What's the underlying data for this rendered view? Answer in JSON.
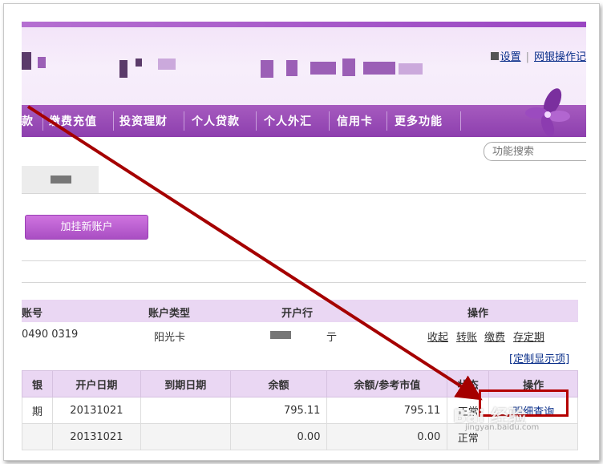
{
  "header": {
    "links": [
      "设置",
      "网银操作记"
    ],
    "search_placeholder": "功能搜索"
  },
  "nav": {
    "items": [
      "款",
      "缴费充值",
      "投资理财",
      "个人贷款",
      "个人外汇",
      "信用卡",
      "更多功能"
    ]
  },
  "actions": {
    "add_account": "加挂新账户"
  },
  "account_table": {
    "headers": [
      "账号",
      "账户类型",
      "开户行",
      "操作"
    ],
    "row": {
      "account_no": "0490 0319",
      "type": "阳光卡",
      "bank_suffix": "亍",
      "ops": [
        "收起",
        "转账",
        "缴费",
        "存定期"
      ]
    },
    "custom_link": "[定制显示项]"
  },
  "detail_table": {
    "headers": [
      "银",
      "开户日期",
      "到期日期",
      "余额",
      "余额/参考市值",
      "状态",
      "操作"
    ],
    "rows": [
      [
        "期",
        "20131021",
        "",
        "795.11",
        "795.11",
        "正常",
        "明细查询"
      ],
      [
        "",
        "20131021",
        "",
        "0.00",
        "0.00",
        "正常",
        ""
      ]
    ]
  },
  "watermark": {
    "text": "Bai 经验",
    "sub": "jingyan.baidu.com"
  },
  "colors": {
    "nav_bg": "#9a4bb8",
    "header_bg": "#f4e8f9",
    "table_header": "#ead7f3",
    "annotation": "#b40000"
  }
}
